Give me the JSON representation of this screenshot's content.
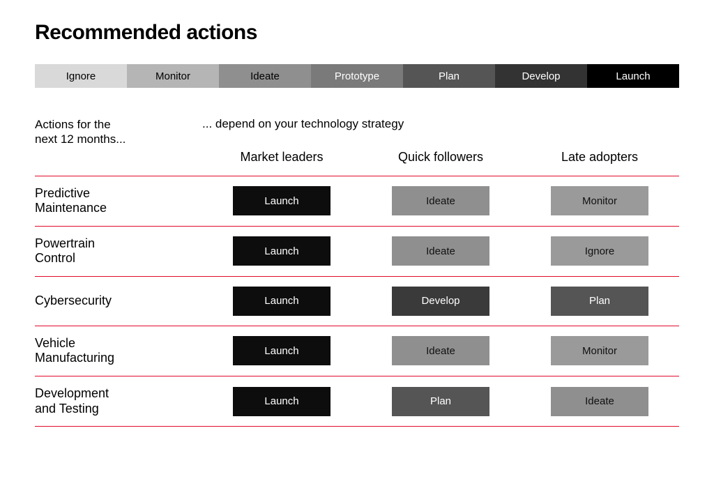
{
  "title": "Recommended actions",
  "scale": [
    {
      "label": "Ignore",
      "bg": "#d9d9d9",
      "tone": "light"
    },
    {
      "label": "Monitor",
      "bg": "#b5b5b5",
      "tone": "light"
    },
    {
      "label": "Ideate",
      "bg": "#8f8f8f",
      "tone": "light"
    },
    {
      "label": "Prototype",
      "bg": "#7a7a7a",
      "tone": "dark"
    },
    {
      "label": "Plan",
      "bg": "#555555",
      "tone": "dark"
    },
    {
      "label": "Develop",
      "bg": "#333333",
      "tone": "dark"
    },
    {
      "label": "Launch",
      "bg": "#000000",
      "tone": "dark"
    }
  ],
  "divider_color": "#e10a2b",
  "headers": {
    "actions_label_line1": "Actions for the",
    "actions_label_line2": "next 12 months...",
    "strategy_label": "... depend on your technology strategy",
    "cols": [
      "Market leaders",
      "Quick followers",
      "Late adopters"
    ]
  },
  "rows": [
    {
      "label_line1": "Predictive",
      "label_line2": "Maintenance",
      "cells": [
        {
          "text": "Launch",
          "bg": "#0d0d0d",
          "fg": "#ffffff"
        },
        {
          "text": "Ideate",
          "bg": "#8f8f8f",
          "fg": "#111111"
        },
        {
          "text": "Monitor",
          "bg": "#9a9a9a",
          "fg": "#111111"
        }
      ]
    },
    {
      "label_line1": "Powertrain",
      "label_line2": "Control",
      "cells": [
        {
          "text": "Launch",
          "bg": "#0d0d0d",
          "fg": "#ffffff"
        },
        {
          "text": "Ideate",
          "bg": "#8f8f8f",
          "fg": "#111111"
        },
        {
          "text": "Ignore",
          "bg": "#9a9a9a",
          "fg": "#111111"
        }
      ]
    },
    {
      "label_line1": "Cybersecurity",
      "label_line2": "",
      "cells": [
        {
          "text": "Launch",
          "bg": "#0d0d0d",
          "fg": "#ffffff"
        },
        {
          "text": "Develop",
          "bg": "#3a3a3a",
          "fg": "#ffffff"
        },
        {
          "text": "Plan",
          "bg": "#555555",
          "fg": "#ffffff"
        }
      ]
    },
    {
      "label_line1": "Vehicle",
      "label_line2": "Manufacturing",
      "cells": [
        {
          "text": "Launch",
          "bg": "#0d0d0d",
          "fg": "#ffffff"
        },
        {
          "text": "Ideate",
          "bg": "#8f8f8f",
          "fg": "#111111"
        },
        {
          "text": "Monitor",
          "bg": "#9a9a9a",
          "fg": "#111111"
        }
      ]
    },
    {
      "label_line1": "Development",
      "label_line2": "and Testing",
      "cells": [
        {
          "text": "Launch",
          "bg": "#0d0d0d",
          "fg": "#ffffff"
        },
        {
          "text": "Plan",
          "bg": "#555555",
          "fg": "#ffffff"
        },
        {
          "text": "Ideate",
          "bg": "#8f8f8f",
          "fg": "#111111"
        }
      ]
    }
  ]
}
